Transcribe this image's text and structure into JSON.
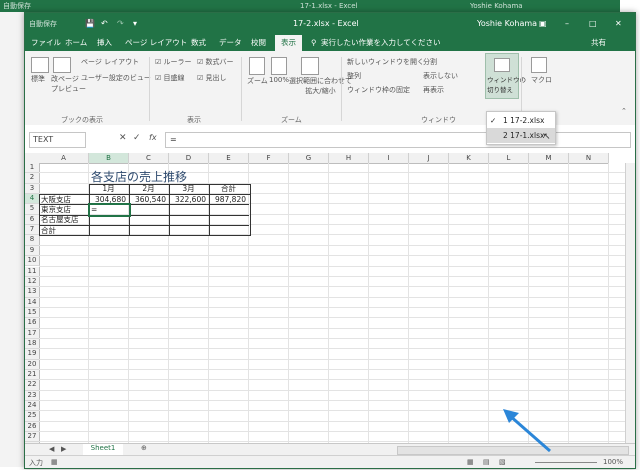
{
  "back_window": {
    "title": "17-1.xlsx - Excel",
    "user": "Yoshie Kohama",
    "autosave": "自動保存"
  },
  "window": {
    "autosave": "自動保存",
    "title": "17-2.xlsx - Excel",
    "user": "Yoshie Kohama"
  },
  "tabs": [
    "ファイル",
    "ホーム",
    "挿入",
    "ページ レイアウト",
    "数式",
    "データ",
    "校閲",
    "表示"
  ],
  "active_tab": "表示",
  "tell_me": "実行したい作業を入力してください",
  "share": "共有",
  "ribbon": {
    "normal": "標準",
    "page_break": "改ページ\nプレビュー",
    "page_layout": "ページ レイアウト",
    "custom_views": "ユーザー設定のビュー",
    "group_views": "ブックの表示",
    "ruler": "ルーラー",
    "formula_bar": "数式バー",
    "gridlines": "目盛線",
    "headings": "見出し",
    "group_show": "表示",
    "zoom": "ズーム",
    "zoom100": "100%",
    "zoom_selection": "選択範囲に合わせて\n拡大/縮小",
    "group_zoom": "ズーム",
    "new_window": "新しいウィンドウを開く",
    "arrange_all": "整列",
    "freeze_panes": "ウィンドウ枠の固定",
    "split": "分割",
    "hide": "表示しない",
    "unhide": "再表示",
    "group_window": "ウィンドウ",
    "switch_windows": "ウィンドウの\n切り替え",
    "macros": "マクロ"
  },
  "switch_dropdown": [
    {
      "label": "1 17-2.xlsx",
      "checked": true
    },
    {
      "label": "2 17-1.xlsx",
      "checked": false
    }
  ],
  "name_box": "TEXT",
  "formula_value": "=",
  "columns": [
    "A",
    "B",
    "C",
    "D",
    "E",
    "F",
    "G",
    "H",
    "I",
    "J",
    "K",
    "L",
    "M",
    "N"
  ],
  "rows": [
    "1",
    "2",
    "3",
    "4",
    "5",
    "6",
    "7",
    "8",
    "9",
    "10",
    "11",
    "12",
    "13",
    "14",
    "15",
    "16",
    "17",
    "18",
    "19",
    "20",
    "21",
    "22",
    "23",
    "24",
    "25",
    "26",
    "27",
    "28"
  ],
  "sheet": {
    "title": "各支店の売上推移",
    "headers": [
      "1月",
      "2月",
      "3月",
      "合計"
    ],
    "row_labels": [
      "大阪支店",
      "東京支店",
      "名古屋支店",
      "合計"
    ],
    "osaka": [
      "304,680",
      "360,540",
      "322,600",
      "987,820"
    ],
    "editing_cell": "="
  },
  "sheet_tab": "Sheet1",
  "status": {
    "mode": "入力",
    "zoom": "100%"
  },
  "annotation_color": "#2b86d8"
}
